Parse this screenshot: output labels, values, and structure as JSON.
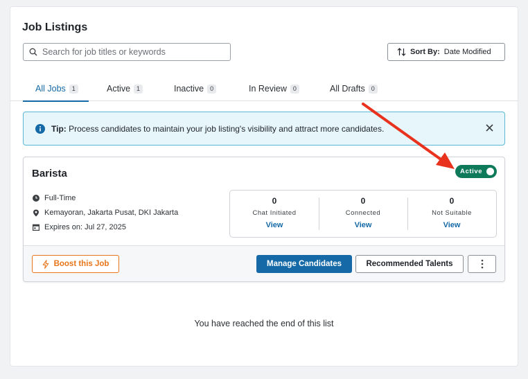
{
  "header": {
    "title": "Job Listings",
    "search_placeholder": "Search for job titles or keywords",
    "sort_label": "Sort By:",
    "sort_value": "Date Modified"
  },
  "tabs": [
    {
      "label": "All Jobs",
      "count": "1",
      "active": true
    },
    {
      "label": "Active",
      "count": "1"
    },
    {
      "label": "Inactive",
      "count": "0"
    },
    {
      "label": "In Review",
      "count": "0"
    },
    {
      "label": "All Drafts",
      "count": "0"
    }
  ],
  "tip": {
    "label": "Tip:",
    "text": "Process candidates to maintain your job listing's visibility and attract more candidates."
  },
  "job": {
    "title": "Barista",
    "status": "Active",
    "type": "Full-Time",
    "location": "Kemayoran, Jakarta Pusat, DKI Jakarta",
    "expires": "Expires on: Jul 27, 2025",
    "stats": [
      {
        "count": "0",
        "label": "Chat Initiated",
        "link": "View"
      },
      {
        "count": "0",
        "label": "Connected",
        "link": "View"
      },
      {
        "count": "0",
        "label": "Not Suitable",
        "link": "View"
      }
    ],
    "boost_label": "Boost this Job",
    "manage_label": "Manage Candidates",
    "recommended_label": "Recommended Talents"
  },
  "footer": {
    "end_text": "You have reached the end of this list"
  },
  "colors": {
    "primary": "#1469a6",
    "active_toggle": "#0e7a5a",
    "boost": "#e8751a",
    "tip_bg": "#e6f6fb",
    "tip_border": "#5bb8d4",
    "annotation_arrow": "#e8321e"
  },
  "icons": [
    "search-icon",
    "sort-icon",
    "info-icon",
    "close-icon",
    "clock-icon",
    "location-pin-icon",
    "calendar-icon",
    "lightning-icon",
    "kebab-menu-icon"
  ]
}
